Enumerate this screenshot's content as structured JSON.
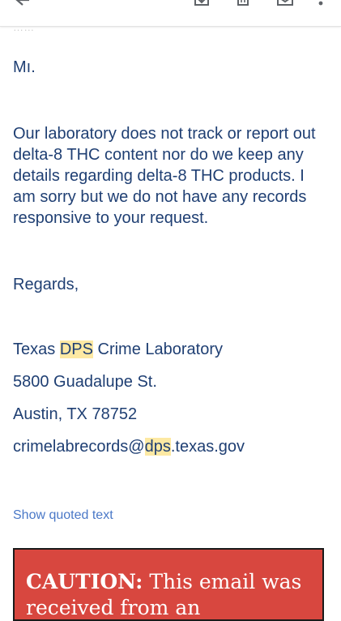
{
  "toolbar": {
    "icons": [
      "back-arrow-icon",
      "download-icon",
      "trash-icon",
      "mail-icon",
      "more-vert-icon"
    ]
  },
  "header_faint": "……",
  "email": {
    "greeting": "Mı.",
    "paragraph": "Our laboratory does not track or report out delta-8 THC content nor do we keep any details regarding delta-8 THC products.  I am sorry but we do not have any records responsive to your request.",
    "closing": "Regards,",
    "signature": {
      "org_prefix": "Texas ",
      "org_highlight": "DPS",
      "org_suffix": " Crime Laboratory",
      "address1": "5800 Guadalupe St.",
      "address2": "Austin, TX 78752",
      "email_prefix": "crimelabrecords@",
      "email_highlight": "dps",
      "email_suffix": ".texas.gov"
    }
  },
  "show_quoted": "Show quoted text",
  "caution": {
    "label": "CAUTION:",
    "text": " This email was received from an"
  },
  "colors": {
    "body_text": "#1f3f73",
    "link": "#4a78c7",
    "highlight": "#fde9a3",
    "caution_bg": "#d8473f"
  }
}
